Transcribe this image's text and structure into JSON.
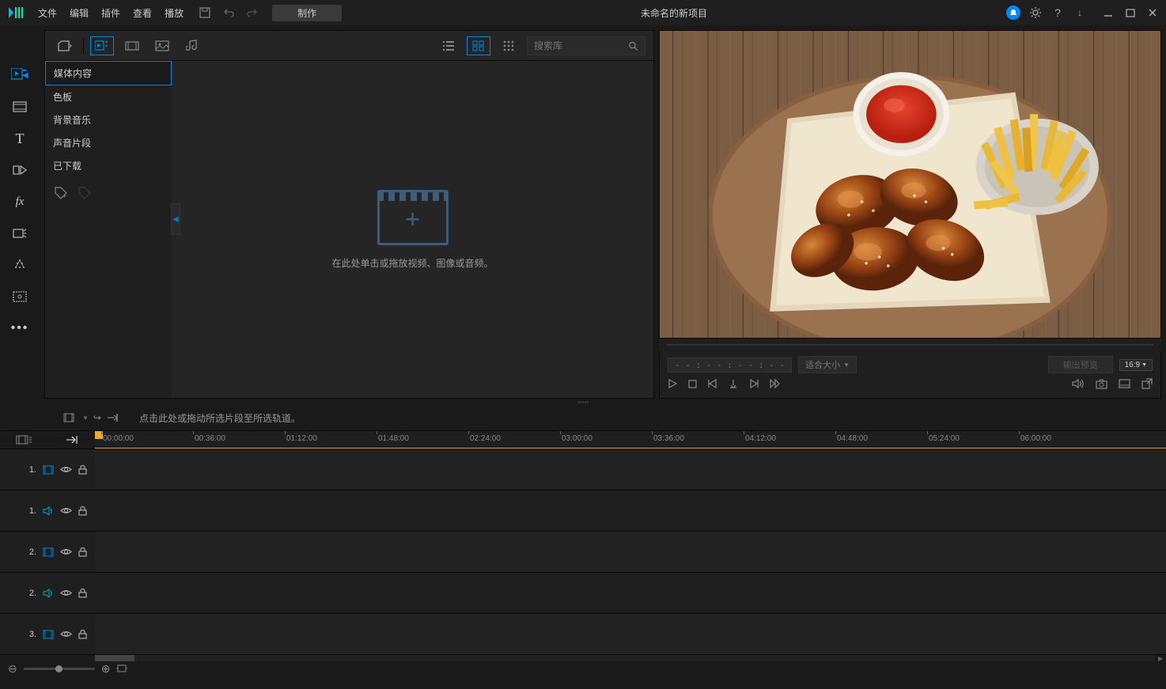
{
  "menu": {
    "file": "文件",
    "edit": "编辑",
    "plugins": "插件",
    "view": "查看",
    "play": "播放"
  },
  "produce": "制作",
  "project_title": "未命名的新项目",
  "library": {
    "search_placeholder": "搜索库",
    "categories": {
      "media": "媒体内容",
      "color": "色板",
      "bgm": "背景音乐",
      "sound": "声音片段",
      "downloaded": "已下载"
    },
    "drop_text": "在此处单击或拖放视频、图像或音频。"
  },
  "preview": {
    "timecode": "- - : - - : - - : - -",
    "fit": "适合大小",
    "render": "输出预览",
    "aspect": "16:9"
  },
  "timeline": {
    "hint": "点击此处或拖动所选片段至所选轨道。",
    "ticks": [
      "00:00:00",
      "00:36:00",
      "01:12:00",
      "01:48:00",
      "02:24:00",
      "03:00:00",
      "03:36:00",
      "04:12:00",
      "04:48:00",
      "05:24:00",
      "06:00:00"
    ],
    "tracks": [
      {
        "num": "1.",
        "type": "video"
      },
      {
        "num": "1.",
        "type": "audio"
      },
      {
        "num": "2.",
        "type": "video"
      },
      {
        "num": "2.",
        "type": "audio"
      },
      {
        "num": "3.",
        "type": "video"
      }
    ]
  }
}
